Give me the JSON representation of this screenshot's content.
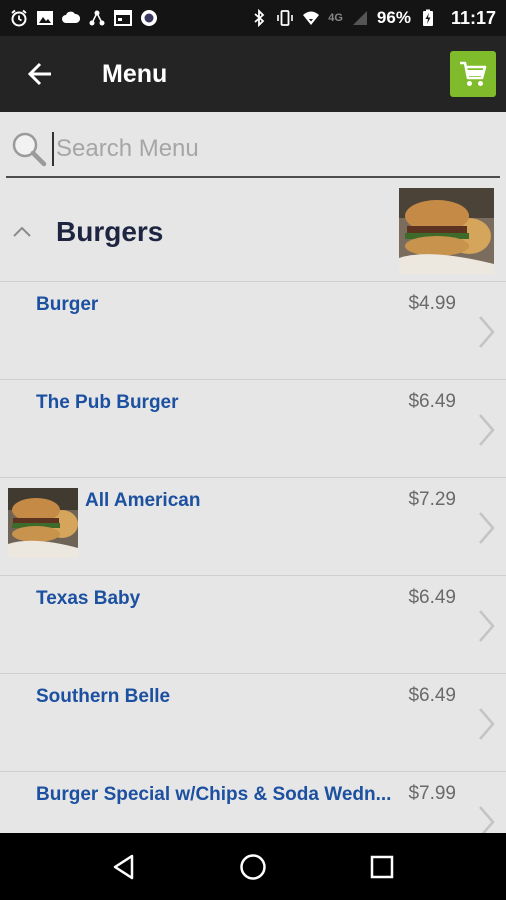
{
  "status_bar": {
    "battery": "96%",
    "time": "11:17",
    "network": "4G"
  },
  "app_bar": {
    "title": "Menu",
    "accent_color": "#7fbb2a"
  },
  "search": {
    "placeholder": "Search Menu",
    "value": ""
  },
  "category": {
    "title": "Burgers",
    "expanded": true
  },
  "items": [
    {
      "name": "Burger",
      "price": "$4.99",
      "has_thumb": false
    },
    {
      "name": "The Pub Burger",
      "price": "$6.49",
      "has_thumb": false
    },
    {
      "name": "All American",
      "price": "$7.29",
      "has_thumb": true
    },
    {
      "name": "Texas Baby",
      "price": "$6.49",
      "has_thumb": false
    },
    {
      "name": "Southern Belle",
      "price": "$6.49",
      "has_thumb": false
    },
    {
      "name": "Burger Special w/Chips & Soda Wedn...",
      "price": "$7.99",
      "has_thumb": false
    }
  ],
  "colors": {
    "item_name": "#1c50a0",
    "background": "#e6e6e6",
    "appbar": "#242424"
  }
}
